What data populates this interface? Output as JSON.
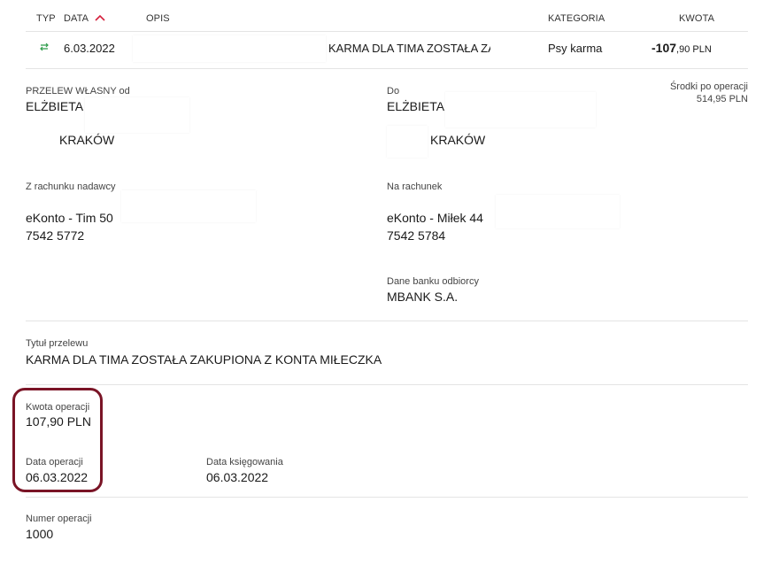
{
  "header": {
    "typ": "TYP",
    "data": "DATA",
    "opis": "OPIS",
    "kategoria": "KATEGORIA",
    "kwota": "KWOTA"
  },
  "transaction": {
    "type_icon": "transfer-arrows-icon",
    "date": "6.03.2022",
    "description": "KARMA DLA TIMA ZOSTAŁA ZAK",
    "category": "Psy karma",
    "amount_int": "-107",
    "amount_frac": ",90 PLN"
  },
  "details": {
    "balance_after_label": "Środki po operacji",
    "balance_after_value": "514,95 PLN",
    "from_label": "PRZELEW WŁASNY od",
    "from_name": "ELŻBIETA",
    "from_city": "KRAKÓW",
    "to_label": "Do",
    "to_name": "ELŻBIETA",
    "to_city": "KRAKÓW",
    "sender_account_label": "Z rachunku nadawcy",
    "sender_account_name": "eKonto - Tim 50",
    "sender_account_number": "7542 5772",
    "recipient_account_label": "Na rachunek",
    "recipient_account_name": "eKonto - Miłek 44",
    "recipient_account_number": "7542 5784",
    "bank_label": "Dane banku odbiorcy",
    "bank_value": "MBANK S.A.",
    "title_label": "Tytuł przelewu",
    "title_value": "KARMA DLA TIMA ZOSTAŁA ZAKUPIONA Z KONTA MIŁECZKA",
    "amount_label": "Kwota operacji",
    "amount_value": "107,90 PLN",
    "op_date_label": "Data operacji",
    "op_date_value": "06.03.2022",
    "book_date_label": "Data księgowania",
    "book_date_value": "06.03.2022",
    "op_number_label": "Numer operacji",
    "op_number_value": "1000"
  },
  "colors": {
    "highlight": "#7a1426",
    "sort_arrow": "#d4213d",
    "transfer_icon": "#2e9c4a"
  }
}
